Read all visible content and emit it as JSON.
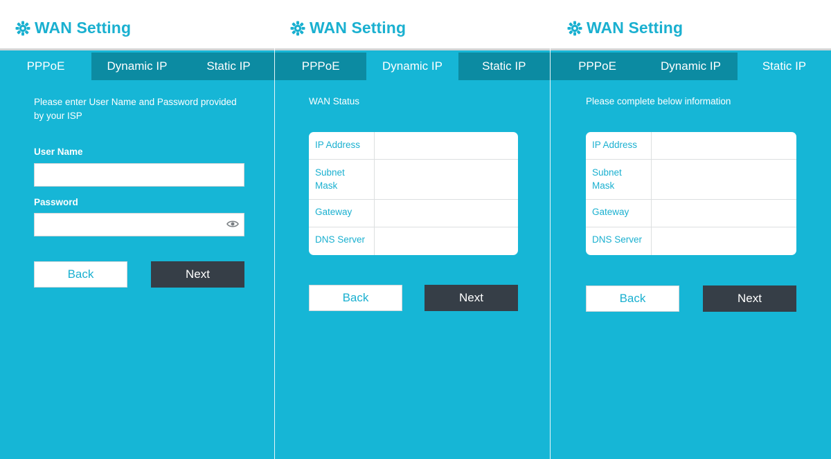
{
  "colors": {
    "panel_bg": "#16b6d6",
    "tab_inactive_bg": "#0c8ba2",
    "title": "#1ab0d0",
    "next_button_bg": "#363e47"
  },
  "icons": {
    "title_icon": "gear-icon",
    "password_toggle": "eye-icon"
  },
  "title": "WAN Setting",
  "tabs": [
    "PPPoE",
    "Dynamic IP",
    "Static IP"
  ],
  "panels": {
    "pppoe": {
      "active_tab": "PPPoE",
      "description": "Please enter User Name and Password provided by your ISP",
      "username_label": "User Name",
      "username_value": "",
      "password_label": "Password",
      "password_value": "",
      "back_label": "Back",
      "next_label": "Next"
    },
    "dynamic": {
      "active_tab": "Dynamic IP",
      "description": "WAN Status",
      "rows": [
        "IP Address",
        "Subnet Mask",
        "Gateway",
        "DNS Server"
      ],
      "back_label": "Back",
      "next_label": "Next"
    },
    "static": {
      "active_tab": "Static IP",
      "description": "Please complete below information",
      "rows": [
        "IP Address",
        "Subnet Mask",
        "Gateway",
        "DNS Server"
      ],
      "back_label": "Back",
      "next_label": "Next"
    }
  }
}
